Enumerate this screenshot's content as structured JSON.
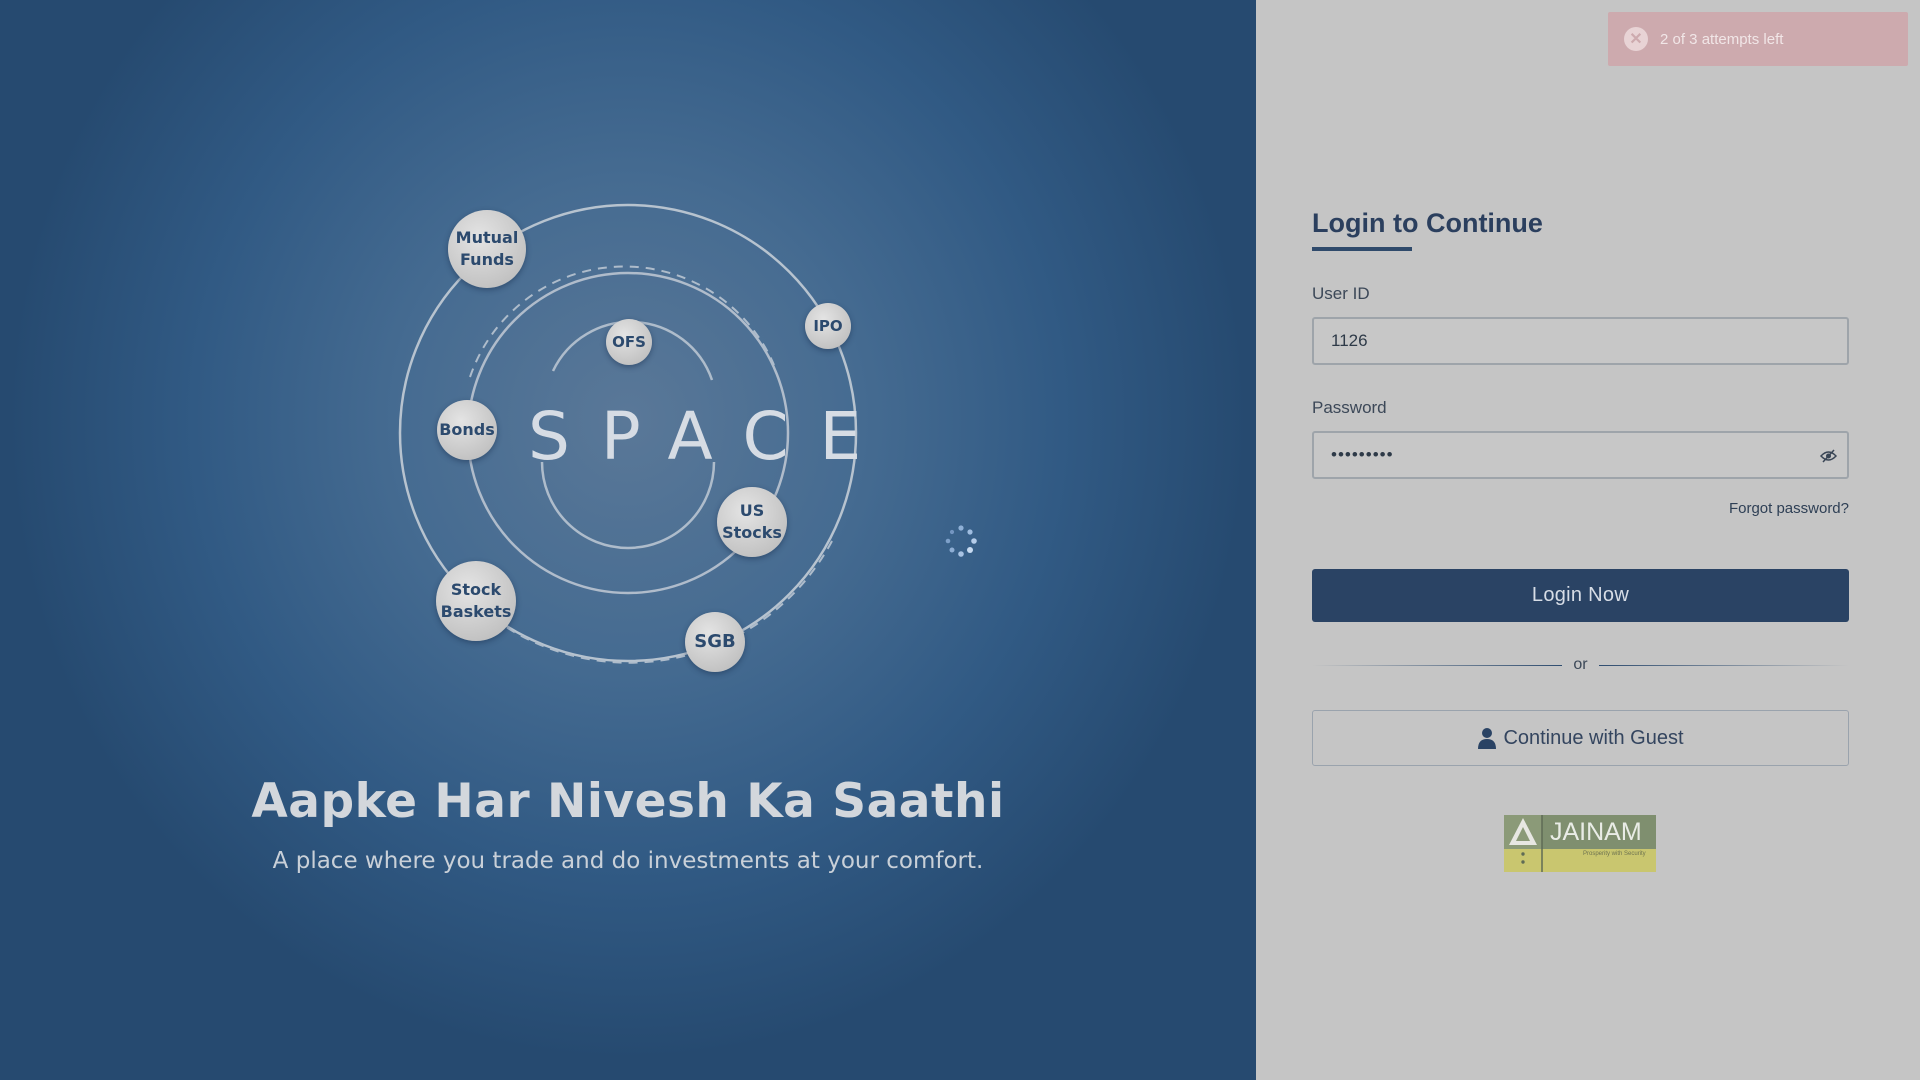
{
  "toast": {
    "icon": "error-x-icon",
    "message": "2 of 3 attempts left"
  },
  "hero": {
    "brand_word": "SPACE",
    "headline": "Aapke Har Nivesh Ka Saathi",
    "tagline": "A place where you trade and do investments at your comfort.",
    "planets": {
      "mutual_funds": [
        "Mutual",
        "Funds"
      ],
      "ipo": "IPO",
      "ofs": "OFS",
      "bonds": "Bonds",
      "us_stocks": [
        "US",
        "Stocks"
      ],
      "stock_baskets": [
        "Stock",
        "Baskets"
      ],
      "sgb": "SGB"
    }
  },
  "login": {
    "title": "Login to Continue",
    "user_id_label": "User ID",
    "user_id_value": "1126",
    "password_label": "Password",
    "password_value": "•••••••••",
    "forgot": "Forgot password?",
    "login_button": "Login Now",
    "divider": "or",
    "guest_button": "Continue with Guest"
  },
  "logo": {
    "name": "JAINAM",
    "tagline": "Prosperity with Security"
  },
  "colors": {
    "primary": "#2a4364",
    "toast_bg": "#cdaaae",
    "panel_bg": "#c5c5c5"
  }
}
